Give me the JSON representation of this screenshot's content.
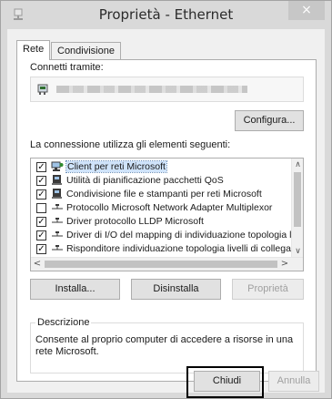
{
  "window": {
    "title": "Proprietà - Ethernet",
    "close_glyph": "×"
  },
  "tabs": [
    {
      "label": "Rete",
      "active": true
    },
    {
      "label": "Condivisione",
      "active": false
    }
  ],
  "connect_using": {
    "label": "Connetti tramite:",
    "icon": "network-adapter-icon"
  },
  "buttons": {
    "configure": "Configura...",
    "install": "Installa...",
    "uninstall": "Disinstalla",
    "properties": "Proprietà",
    "close": "Chiudi",
    "cancel": "Annulla"
  },
  "items_label": "La connessione utilizza gli elementi seguenti:",
  "items": [
    {
      "label": "Client per reti Microsoft",
      "checked": true,
      "icon": "network-client-icon",
      "selected": true
    },
    {
      "label": "Utilità di pianificazione pacchetti QoS",
      "checked": true,
      "icon": "network-service-icon",
      "selected": false
    },
    {
      "label": "Condivisione file e stampanti per reti Microsoft",
      "checked": true,
      "icon": "network-service-icon",
      "selected": false
    },
    {
      "label": "Protocollo Microsoft Network Adapter Multiplexor",
      "checked": false,
      "icon": "protocol-icon",
      "selected": false
    },
    {
      "label": "Driver protocollo LLDP Microsoft",
      "checked": true,
      "icon": "protocol-icon",
      "selected": false
    },
    {
      "label": "Driver di I/O del mapping di individuazione topologia livelli c",
      "checked": true,
      "icon": "protocol-icon",
      "selected": false
    },
    {
      "label": "Risponditore individuazione topologia livelli di collegamento",
      "checked": true,
      "icon": "protocol-icon",
      "selected": false
    }
  ],
  "description": {
    "title": "Descrizione",
    "text": "Consente al proprio computer di accedere a risorse in una rete Microsoft."
  }
}
